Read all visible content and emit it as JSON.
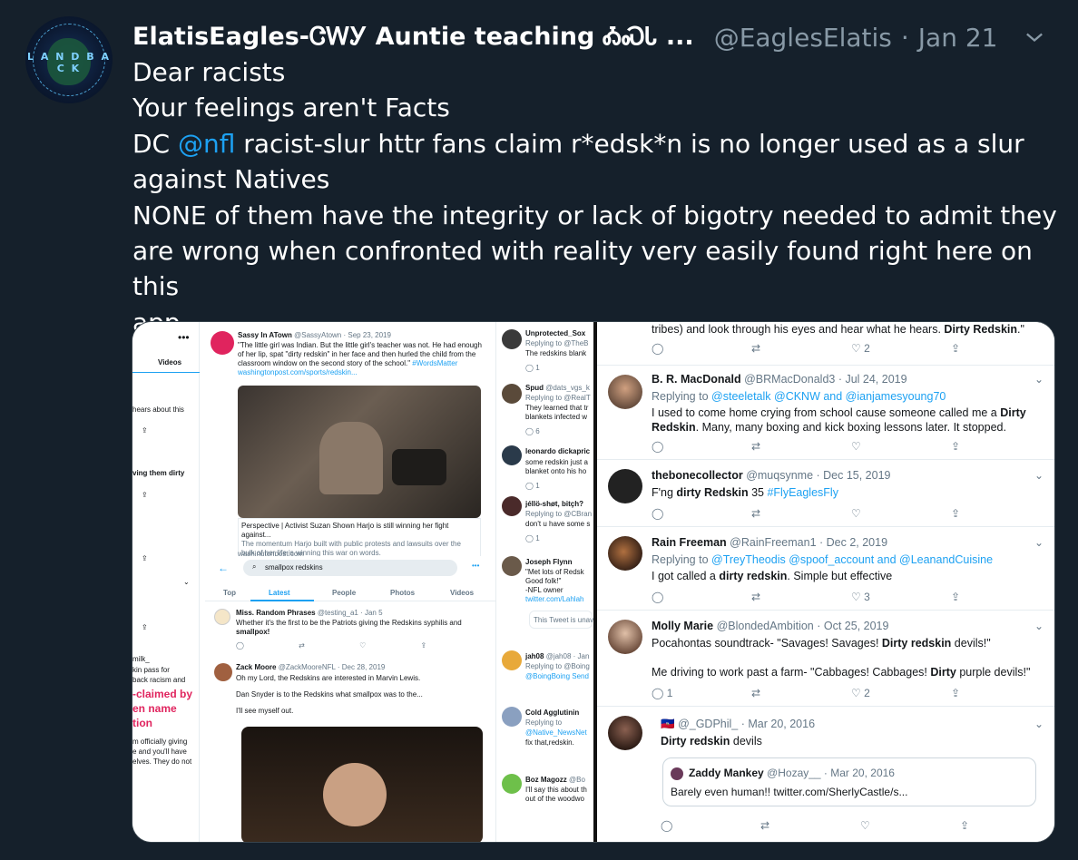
{
  "tweet": {
    "display_name": "ElatisEagles-ᏣᎳᎩ Auntie teaching ᎣᏍᏓ ...",
    "handle": "@EaglesElatis",
    "date": "Jan 21",
    "separator": "·",
    "lines": [
      "Dear racists",
      "Your feelings aren't Facts"
    ],
    "line3_pre": "DC ",
    "line3_mention": "@nfl",
    "line3_post": " racist-slur httr fans claim r*edsk*n is no longer used as a slur",
    "line4": "against Natives",
    "line5": "NONE of them have the integrity or lack of bigotry needed to admit they",
    "line6": "are wrong when confronted with reality very easily found right here on this",
    "line7": "app"
  },
  "avatar": {
    "letters": "L A N D B A C K"
  },
  "left": {
    "col1": {
      "videos": "Videos",
      "hears": "hears about this",
      "dirty": "ving them dirty",
      "milk": "milk_",
      "kin": "kin pass for",
      "back": "back racism and",
      "claimed1": "-claimed by",
      "claimed2": "en name",
      "claimed3": "tion",
      "officially": "m officially giving",
      "have": "e and you'll have",
      "selves": "elves. They do not"
    },
    "card": {
      "name": "Sassy In ATown",
      "handle": "@SassyAtown · Sep 23, 2019",
      "text1": "\"The little girl was Indian. But the little girl's teacher was not. He had enough",
      "text2": "of her lip, spat \"dirty redskin\" in her face and then hurled the child from the",
      "text3": "classroom window on the second story of the school.\"",
      "hashtag": "#WordsMatter",
      "link": "washingtonpost.com/sports/redskin...",
      "caption1": "Perspective | Activist Suzan Shown Harjo is still winning her fight against...",
      "caption2": "The momentum Harjo built with public protests and lawsuits over the",
      "caption3": "bulk of her life is winning this war on words.",
      "source": "washingtonpost.com"
    },
    "search": {
      "query": "smallpox redskins",
      "tabs": [
        "Top",
        "Latest",
        "People",
        "Photos",
        "Videos"
      ],
      "t1_name": "Miss. Random Phrases",
      "t1_handle": "@testing_a1 · Jan 5",
      "t1_text1": "Whether it's the first to be the Patriots giving the Redskins syphilis and",
      "t1_text2": "smallpox!",
      "t2_name": "Zack Moore",
      "t2_handle": "@ZackMooreNFL · Dec 28, 2019",
      "t2_text1": "Oh my Lord, the Redskins are interested in Marvin Lewis.",
      "t2_text2": "Dan Snyder is to the Redskins what smallpox was to the...",
      "t2_text3": "I'll see myself out."
    },
    "col3": {
      "a_name": "Unprotected_Sox",
      "a_reply": "Replying to @TheB",
      "a_text": "The redskins blank",
      "a_count": "1",
      "b_name": "Spud",
      "b_handle": "@dats_vgs_k",
      "b_reply": "Replying to @RealT",
      "b_text1": "They learned that tr",
      "b_text2": "blankets infected w",
      "b_count": "6",
      "c_name": "leonardo dickapric",
      "c_text1": "some redskin just a",
      "c_text2": "blanket onto his ho",
      "c_count": "1",
      "d_name": "jéllö-shøt, bitçh?",
      "d_reply": "Replying to @CBran",
      "d_text": "don't u have some s",
      "d_count": "1",
      "e_name": "Joseph Flynn",
      "e_text1": "\"Met lots of Redsk",
      "e_text2": "Good folk!\"",
      "e_text3": "-NFL owner",
      "e_link": "twitter.com/Lahlah",
      "e_unavailable": "This Tweet is unav",
      "f_name": "jah08",
      "f_handle": "@jah08 · Jan",
      "f_reply": "Replying to @Boing",
      "f_reply2": "@BoingBoing Send",
      "g_name": "Cold Agglutinin",
      "g_reply": "Replying to",
      "g_reply2": "@Native_NewsNet",
      "g_text": "fix that,redskin.",
      "h_name": "Boz Magozz",
      "h_handle": "@Bo",
      "h_text1": "I'll say this about th",
      "h_text2": "out of the woodwo"
    }
  },
  "right": {
    "top_text_pre": "tribes) and look through his eyes and hear what he hears. ",
    "top_text_bold": "Dirty Redskin",
    "top_text_post": ".\"",
    "top_like": "2",
    "tweets": [
      {
        "name": "B. R. MacDonald",
        "handle": "@BRMacDonald3 · Jul 24, 2019",
        "reply_label": "Replying to",
        "reply_to": "@steeletalk @CKNW and @ianjamesyoung70",
        "text1_pre": "I used to come home crying from school cause someone called me a ",
        "text1_bold": "Dirty",
        "text2_bold": "Redskin",
        "text2_post": ". Many,  many boxing and kick boxing lessons later. It stopped."
      },
      {
        "name": "thebonecollector",
        "handle": "@muqsynme · Dec 15, 2019",
        "text_pre": "F'ng ",
        "text_bold": "dirty Redskin",
        "text_mid": " 35 ",
        "hashtag": "#FlyEaglesFly"
      },
      {
        "name": "Rain Freeman",
        "handle": "@RainFreeman1 · Dec 2, 2019",
        "reply_label": "Replying to",
        "reply_to": "@TreyTheodis @spoof_account and @LeanandCuisine",
        "text_pre": "I got called a ",
        "text_bold": "dirty redskin",
        "text_post": ". Simple but effective",
        "likes": "3"
      },
      {
        "name": "Molly Marie",
        "handle": "@BlondedAmbition · Oct 25, 2019",
        "text1_pre": "Pocahontas soundtrack- \"Savages! Savages! ",
        "text1_bold": "Dirty redskin",
        "text1_post": " devils!\"",
        "text2_pre": "Me driving to work past a farm- \"Cabbages! Cabbages! ",
        "text2_bold": "Dirty",
        "text2_post": " purple devils!\"",
        "replies": "1",
        "likes": "2"
      },
      {
        "name": "@_GDPhil_",
        "handle": "· Mar 20, 2016",
        "text_bold": "Dirty redskin",
        "text_post": " devils",
        "quote_name": "Zaddy Mankey",
        "quote_handle": "@Hozay__ · Mar 20, 2016",
        "quote_text": "Barely even human!! twitter.com/SherlyCastle/s..."
      }
    ]
  },
  "colors": {
    "background": "#15202b",
    "accent": "#1da1f2",
    "muted": "#8899a6"
  }
}
